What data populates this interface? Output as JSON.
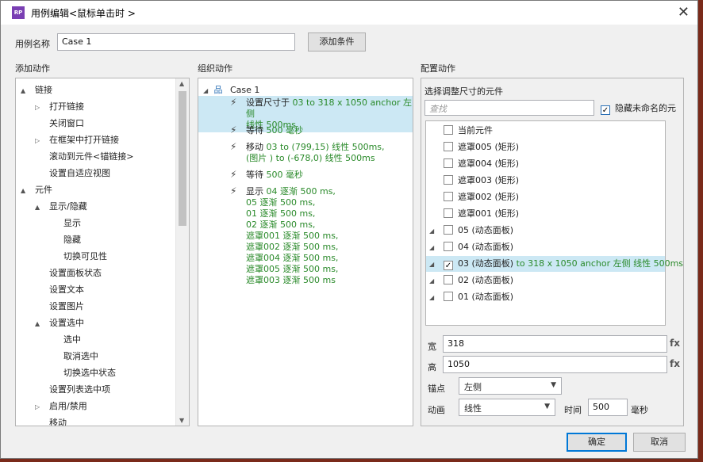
{
  "window": {
    "title": "用例编辑<鼠标单击时 >",
    "icon": "RP"
  },
  "case_name": {
    "label": "用例名称",
    "value": "Case 1",
    "add_condition": "添加条件"
  },
  "sections": {
    "add_action": "添加动作",
    "organize_action": "组织动作",
    "config_action": "配置动作"
  },
  "add_actions": {
    "items": [
      {
        "level": 0,
        "expander": "▲",
        "label": "链接"
      },
      {
        "level": 1,
        "expander": "▷",
        "label": "打开链接"
      },
      {
        "level": 1,
        "expander": "",
        "label": "关闭窗口"
      },
      {
        "level": 1,
        "expander": "▷",
        "label": "在框架中打开链接"
      },
      {
        "level": 1,
        "expander": "",
        "label": "滚动到元件<锚链接>"
      },
      {
        "level": 1,
        "expander": "",
        "label": "设置自适应视图"
      },
      {
        "level": 0,
        "expander": "▲",
        "label": "元件"
      },
      {
        "level": 1,
        "expander": "▲",
        "label": "显示/隐藏"
      },
      {
        "level": 2,
        "expander": "",
        "label": "显示"
      },
      {
        "level": 2,
        "expander": "",
        "label": "隐藏"
      },
      {
        "level": 2,
        "expander": "",
        "label": "切换可见性"
      },
      {
        "level": 1,
        "expander": "",
        "label": "设置面板状态"
      },
      {
        "level": 1,
        "expander": "",
        "label": "设置文本"
      },
      {
        "level": 1,
        "expander": "",
        "label": "设置图片"
      },
      {
        "level": 1,
        "expander": "▲",
        "label": "设置选中"
      },
      {
        "level": 2,
        "expander": "",
        "label": "选中"
      },
      {
        "level": 2,
        "expander": "",
        "label": "取消选中"
      },
      {
        "level": 2,
        "expander": "",
        "label": "切换选中状态"
      },
      {
        "level": 1,
        "expander": "",
        "label": "设置列表选中项"
      },
      {
        "level": 1,
        "expander": "▷",
        "label": "启用/禁用"
      },
      {
        "level": 1,
        "expander": "",
        "label": "移动"
      }
    ]
  },
  "organize": {
    "case_label": "Case 1",
    "actions": [
      {
        "verb": "设置尺寸于",
        "lines": [
          "03 to 318 x 1050 anchor 左侧",
          "线性 500ms"
        ],
        "selected": true
      },
      {
        "verb": "等待",
        "lines": [
          "500 毫秒"
        ],
        "selected": false
      },
      {
        "verb": "移动",
        "lines": [
          "03 to (799,15) 线性 500ms,",
          "(图片 ) to (-678,0) 线性 500ms"
        ],
        "selected": false
      },
      {
        "verb": "等待",
        "lines": [
          "500 毫秒"
        ],
        "selected": false
      },
      {
        "verb": "显示",
        "lines": [
          "04 逐渐 500 ms,",
          "05 逐渐 500 ms,",
          "01 逐渐 500 ms,",
          "02 逐渐 500 ms,",
          "遮罩001 逐渐 500 ms,",
          "遮罩002 逐渐 500 ms,",
          "遮罩004 逐渐 500 ms,",
          "遮罩005 逐渐 500 ms,",
          "遮罩003 逐渐 500 ms"
        ],
        "selected": false
      }
    ]
  },
  "config": {
    "subtitle": "选择调整尺寸的元件",
    "search_placeholder": "查找",
    "hide_unnamed": {
      "label": "隐藏未命名的元",
      "checked": true
    },
    "widgets": [
      {
        "expander": "",
        "checked": false,
        "name": "当前元件",
        "detail": ""
      },
      {
        "expander": "",
        "checked": false,
        "name": "遮罩005 (矩形)",
        "detail": ""
      },
      {
        "expander": "",
        "checked": false,
        "name": "遮罩004 (矩形)",
        "detail": ""
      },
      {
        "expander": "",
        "checked": false,
        "name": "遮罩003 (矩形)",
        "detail": ""
      },
      {
        "expander": "",
        "checked": false,
        "name": "遮罩002 (矩形)",
        "detail": ""
      },
      {
        "expander": "",
        "checked": false,
        "name": "遮罩001 (矩形)",
        "detail": ""
      },
      {
        "expander": "◢",
        "checked": false,
        "name": "05 (动态面板)",
        "detail": ""
      },
      {
        "expander": "◢",
        "checked": false,
        "name": "04 (动态面板)",
        "detail": ""
      },
      {
        "expander": "◢",
        "checked": true,
        "name": "03 (动态面板)",
        "detail": " to 318 x 1050 anchor 左侧 线性 500ms",
        "selected": true
      },
      {
        "expander": "◢",
        "checked": false,
        "name": "02 (动态面板)",
        "detail": ""
      },
      {
        "expander": "◢",
        "checked": false,
        "name": "01 (动态面板)",
        "detail": ""
      }
    ],
    "width": {
      "label": "宽",
      "value": "318",
      "fx": "fx"
    },
    "height": {
      "label": "高",
      "value": "1050",
      "fx": "fx"
    },
    "anchor": {
      "label": "锚点",
      "value": "左侧"
    },
    "animation": {
      "label": "动画",
      "value": "线性",
      "time_label": "时间",
      "time_value": "500",
      "unit": "毫秒"
    }
  },
  "footer": {
    "ok": "确定",
    "cancel": "取消"
  },
  "colors": {
    "selection": "#cce8f4",
    "green_text": "#2a8a2a"
  }
}
